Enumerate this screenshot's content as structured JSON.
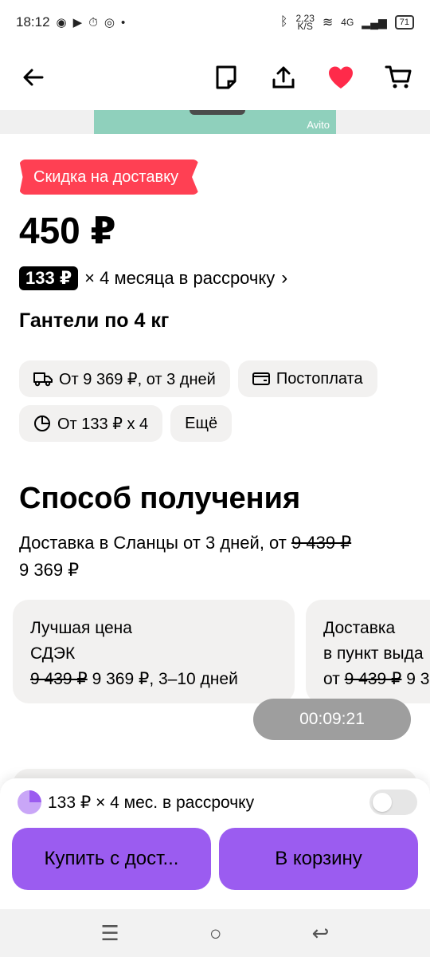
{
  "status_bar": {
    "time": "18:12",
    "speed": "2,23",
    "speed_unit": "K/S",
    "network": "4G",
    "battery": "71"
  },
  "nav": {
    "icons": [
      "back-arrow-icon",
      "note-icon",
      "share-icon",
      "heart-icon",
      "cart-icon"
    ],
    "accent_heart": "#ff2a4a"
  },
  "gallery": {
    "watermark": "Avito"
  },
  "product": {
    "discount_badge": "Скидка на доставку",
    "price": "450 ₽",
    "installment_amount": "133 ₽",
    "installment_text": "× 4 месяца в рассрочку",
    "title": "Гантели по 4 кг"
  },
  "chips": [
    {
      "icon": "truck-icon",
      "label": "От 9 369 ₽, от 3 дней"
    },
    {
      "icon": "wallet-icon",
      "label": "Постоплата"
    },
    {
      "icon": "pie-chart-icon",
      "label": "От 133 ₽ х 4"
    },
    {
      "icon": "",
      "label": "Ещё"
    }
  ],
  "delivery": {
    "section_title": "Способ получения",
    "line_prefix": "Доставка в Сланцы от 3 дней, от ",
    "old_price": "9 439 ₽",
    "new_price": "9 369 ₽",
    "cards": [
      {
        "title": "Лучшая цена",
        "carrier": "СДЭК",
        "old_price": "9 439 ₽",
        "rest": " 9 369 ₽, 3–10 дней"
      },
      {
        "title": "Доставка",
        "carrier": "в пункт выда",
        "prefix": "от ",
        "old_price": "9 439 ₽",
        "rest": " 9 3"
      }
    ]
  },
  "timer": "00:09:21",
  "bottom_sheet": {
    "installment_text": "133 ₽ × 4 мес. в рассрочку",
    "toggle_on": false,
    "buy_button": "Купить с дост...",
    "cart_button": "В корзину",
    "accent": "#9b5cf0"
  },
  "system_nav": {
    "menu": "☰",
    "home": "○",
    "back": "↩"
  }
}
